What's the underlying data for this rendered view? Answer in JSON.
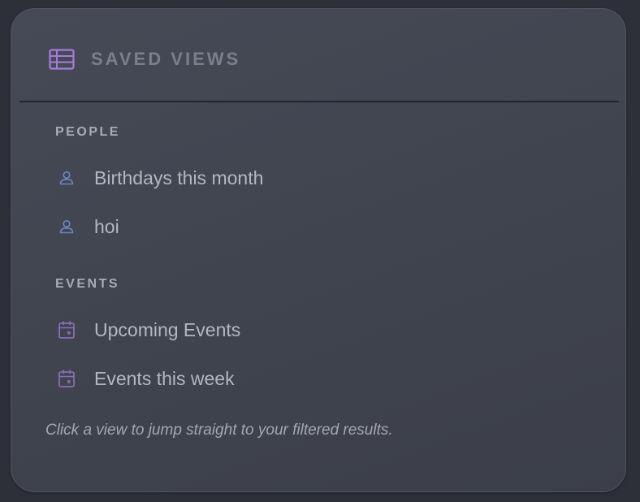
{
  "panel": {
    "title": "SAVED VIEWS",
    "title_icon": "table-icon",
    "accent_color": "#a77bdc"
  },
  "sections": [
    {
      "label": "PEOPLE",
      "items": [
        {
          "label": "Birthdays this month",
          "icon": "person-icon",
          "icon_color": "#6e86c6"
        },
        {
          "label": "hoi",
          "icon": "person-icon",
          "icon_color": "#6e86c6"
        }
      ]
    },
    {
      "label": "EVENTS",
      "items": [
        {
          "label": "Upcoming Events",
          "icon": "calendar-icon",
          "icon_color": "#8a6db3"
        },
        {
          "label": "Events this week",
          "icon": "calendar-icon",
          "icon_color": "#8a6db3"
        }
      ]
    }
  ],
  "footer": {
    "note": "Click a view to jump straight to your filtered results."
  }
}
